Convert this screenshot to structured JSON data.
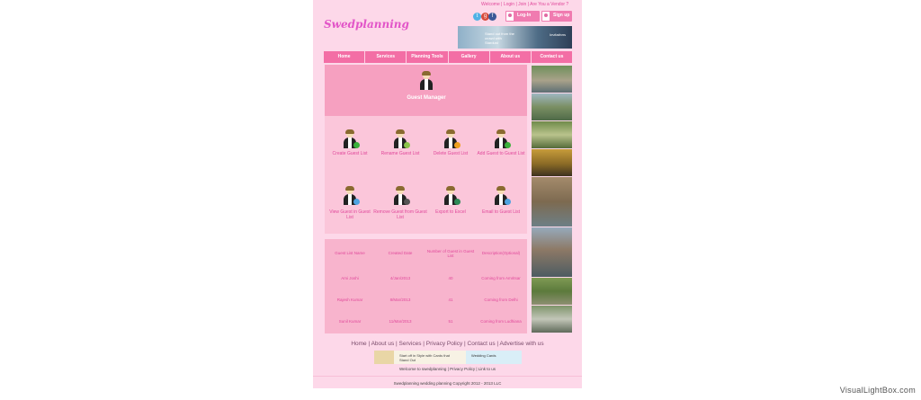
{
  "header": {
    "top_links": "Welcome | Login | Join | Are You a Vendor ?",
    "logo": "Swedplanning",
    "login_label": "Log-In",
    "signup_label": "Sign up",
    "banner_text_1": "Stand out from the crowd with Stardust",
    "banner_text_2": "Invitations"
  },
  "nav": {
    "items": [
      "Home",
      "Services",
      "Planning Tools",
      "Gallery",
      "About us",
      "Contact us"
    ]
  },
  "guest_manager": {
    "title": "Guest Manager",
    "tools": [
      {
        "label": "Create Guest List"
      },
      {
        "label": "Rename Guest List"
      },
      {
        "label": "Delete Guest List"
      },
      {
        "label": "Add Guest to Guest List"
      },
      {
        "label": "View Guest in Guest List"
      },
      {
        "label": "Remove Guest from Guest List"
      },
      {
        "label": "Export to Excel"
      },
      {
        "label": "Email to Guest List"
      }
    ]
  },
  "guest_table": {
    "headers": [
      "Guest List Name",
      "Created Date",
      "Number of Guest in Guest List",
      "Description(Optional)"
    ],
    "rows": [
      [
        "Ami Joshi",
        "4/Jan/2013",
        "40",
        "Coming from Amritsar"
      ],
      [
        "Rajesh Kumar",
        "8/Mar/2013",
        "41",
        "Coming from Delhi"
      ],
      [
        "Sunil Kumar",
        "11/Mar/2013",
        "51",
        "Coming from Ludhiana"
      ]
    ]
  },
  "footer": {
    "links": "Home | About us | Services | Privacy Policy | Contact us | Advertise with us",
    "ad_text": "Start off in Style with Cards that Stand Out",
    "ad_brand": "Wedding Cards",
    "welcome_line": "Welcome to swedplanning | Privacy Policy | Link to us",
    "copyright": "Swedplanning wedding planning Copyright 2012 - 2013 LLC"
  },
  "watermark": "VisualLightBox.com",
  "colors": {
    "page_bg": "#fdd8e9",
    "nav_bg": "#f36ea5",
    "accent_text": "#e0479a"
  }
}
